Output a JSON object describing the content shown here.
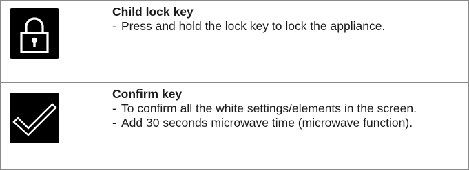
{
  "keys": [
    {
      "icon": "padlock-icon",
      "title": "Child lock key",
      "dash": "-",
      "lines": [
        "Press and hold the lock key to lock the appliance."
      ]
    },
    {
      "icon": "checkmark-icon",
      "title": "Confirm key",
      "dash": "-",
      "lines": [
        "To confirm all the white settings/elements in the screen.",
        "Add 30 seconds microwave time (microwave function)."
      ]
    }
  ],
  "colors": {
    "icon_background": "#000000",
    "icon_foreground": "#ffffff",
    "border": "#8a8a8a"
  }
}
